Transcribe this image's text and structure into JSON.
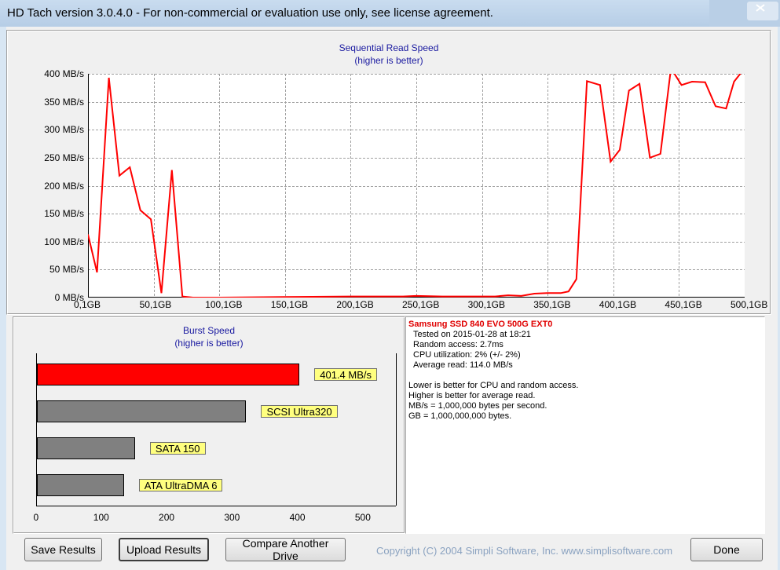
{
  "window": {
    "title": "HD Tach version 3.0.4.0  - For non-commercial or evaluation use only, see license agreement."
  },
  "read_chart": {
    "title": "Sequential Read Speed",
    "subtitle": "(higher is better)",
    "y_ticks": [
      "400 MB/s",
      "350 MB/s",
      "300 MB/s",
      "250 MB/s",
      "200 MB/s",
      "150 MB/s",
      "100 MB/s",
      "50 MB/s",
      "0 MB/s"
    ],
    "x_ticks": [
      "0,1GB",
      "50,1GB",
      "100,1GB",
      "150,1GB",
      "200,1GB",
      "250,1GB",
      "300,1GB",
      "350,1GB",
      "400,1GB",
      "450,1GB",
      "500,1GB"
    ]
  },
  "burst_chart": {
    "title": "Burst Speed",
    "subtitle": "(higher is better)",
    "x_ticks": [
      "0",
      "100",
      "200",
      "300",
      "400",
      "500"
    ],
    "bars": [
      {
        "label": "401.4 MB/s",
        "value": 401.4,
        "color": "#ff0000"
      },
      {
        "label": "SCSI Ultra320",
        "value": 320,
        "color": "#808080"
      },
      {
        "label": "SATA 150",
        "value": 150,
        "color": "#808080"
      },
      {
        "label": "ATA UltraDMA 6",
        "value": 133,
        "color": "#808080"
      }
    ]
  },
  "info": {
    "drive_name": "Samsung SSD 840 EVO 500G EXT0",
    "tested_on": "Tested on 2015-01-28 at 18:21",
    "random_access": "Random access: 2.7ms",
    "cpu_utilization": "CPU utilization: 2% (+/- 2%)",
    "average_read": "Average read: 114.0 MB/s",
    "note1": "Lower is better for CPU and random access.",
    "note2": "Higher is better for average read.",
    "note3": "MB/s = 1,000,000 bytes per second.",
    "note4": "GB = 1,000,000,000 bytes."
  },
  "buttons": {
    "save": "Save Results",
    "upload": "Upload Results",
    "compare": "Compare Another Drive",
    "done": "Done"
  },
  "copyright": "Copyright (C) 2004 Simpli Software, Inc. www.simplisoftware.com",
  "chart_data": [
    {
      "type": "line",
      "title": "Sequential Read Speed",
      "subtitle": "(higher is better)",
      "xlabel": "",
      "ylabel": "",
      "x_unit": "GB",
      "y_unit": "MB/s",
      "xlim": [
        0.1,
        500.1
      ],
      "ylim": [
        0,
        400
      ],
      "grid": true,
      "series": [
        {
          "color": "#ff0000",
          "x": [
            0.1,
            7,
            16,
            24,
            32,
            40,
            48,
            56,
            64,
            72,
            80,
            100,
            150,
            200,
            240,
            250,
            270,
            300,
            310,
            320,
            330,
            340,
            350,
            360,
            366,
            372,
            380,
            390,
            398,
            405,
            412,
            420,
            428,
            436,
            444,
            452,
            460,
            470,
            478,
            486,
            492,
            500.1
          ],
          "y": [
            113,
            45,
            393,
            218,
            233,
            156,
            140,
            8,
            228,
            2,
            0,
            0,
            1,
            2,
            2,
            3,
            2,
            2,
            2,
            4,
            3,
            7,
            8,
            8,
            11,
            33,
            387,
            380,
            243,
            264,
            370,
            382,
            250,
            257,
            410,
            380,
            386,
            385,
            342,
            338,
            386,
            410
          ]
        }
      ]
    },
    {
      "type": "bar",
      "orientation": "horizontal",
      "title": "Burst Speed",
      "subtitle": "(higher is better)",
      "categories": [
        "401.4 MB/s",
        "SCSI Ultra320",
        "SATA 150",
        "ATA UltraDMA 6"
      ],
      "values": [
        401.4,
        320,
        150,
        133
      ],
      "xlim": [
        0,
        550
      ],
      "grid": false
    }
  ]
}
